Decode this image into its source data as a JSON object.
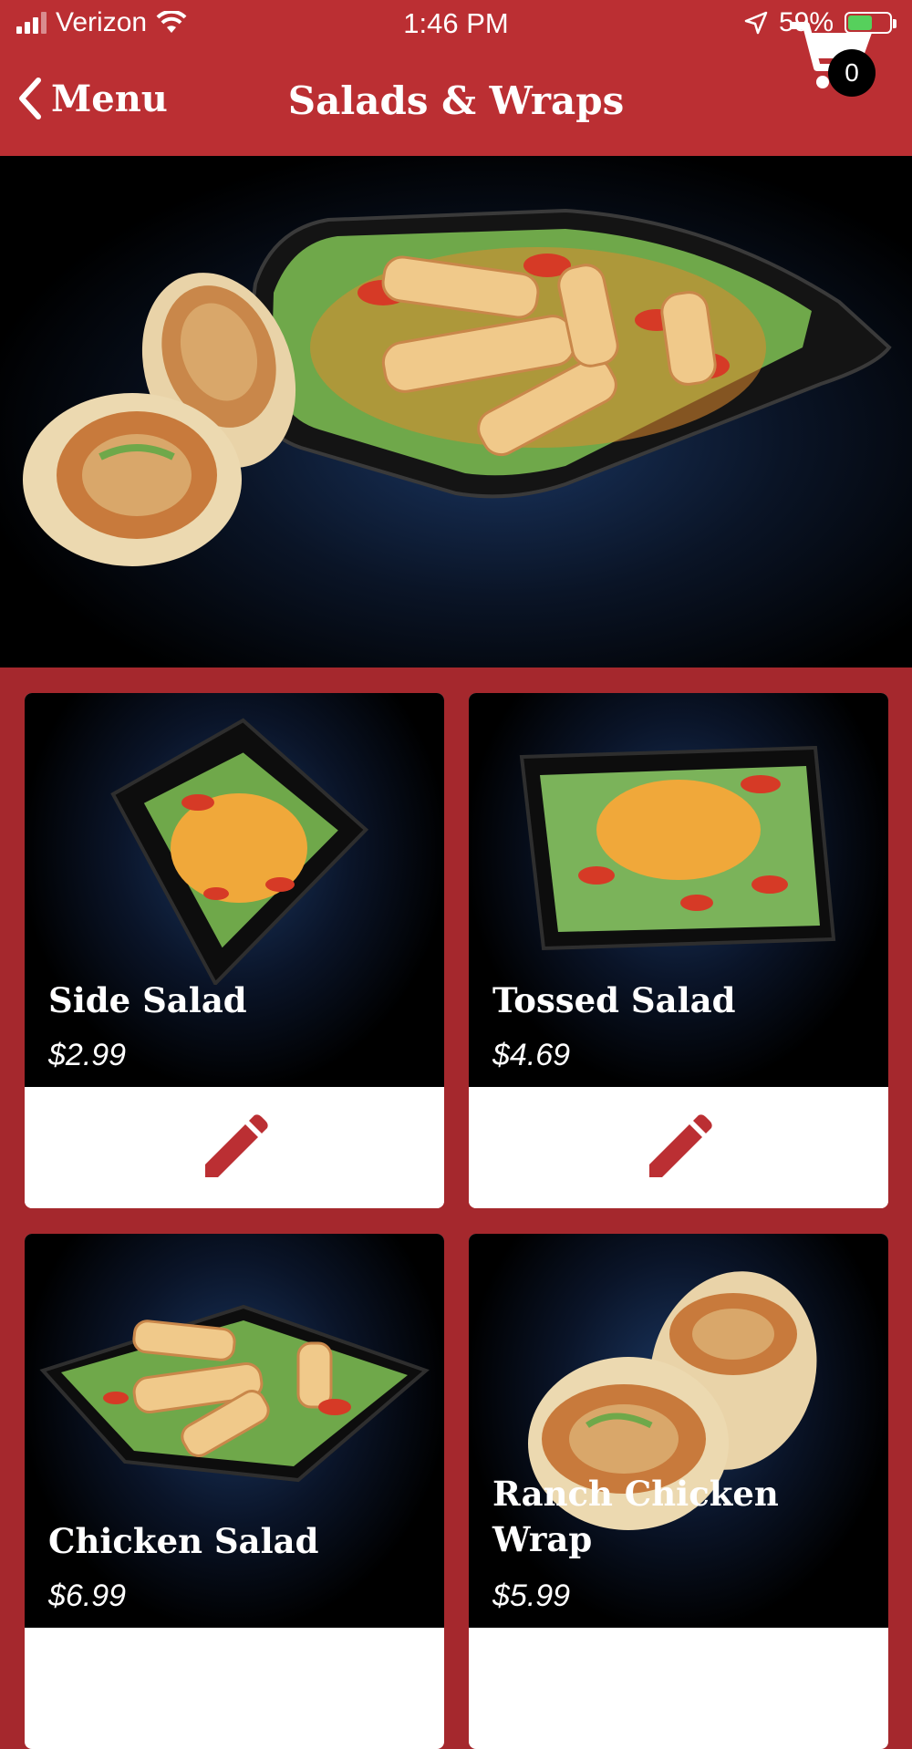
{
  "status_bar": {
    "carrier": "Verizon",
    "time": "1:46 PM",
    "battery": "59%",
    "battery_level": 0.59
  },
  "header": {
    "back_label": "Menu",
    "title": "Salads & Wraps",
    "cart_count": "0"
  },
  "items": [
    {
      "name": "Side Salad",
      "price": "$2.99"
    },
    {
      "name": "Tossed Salad",
      "price": "$4.69"
    },
    {
      "name": "Chicken Salad",
      "price": "$6.99"
    },
    {
      "name": "Ranch Chicken Wrap",
      "price": "$5.99"
    }
  ],
  "colors": {
    "brand_red": "#bb2f33",
    "background_red": "#a5282d",
    "battery_green": "#56d05c"
  },
  "icons": [
    "signal-icon",
    "wifi-icon",
    "location-arrow-icon",
    "battery-icon",
    "chevron-left-icon",
    "cart-icon",
    "pencil-icon"
  ]
}
